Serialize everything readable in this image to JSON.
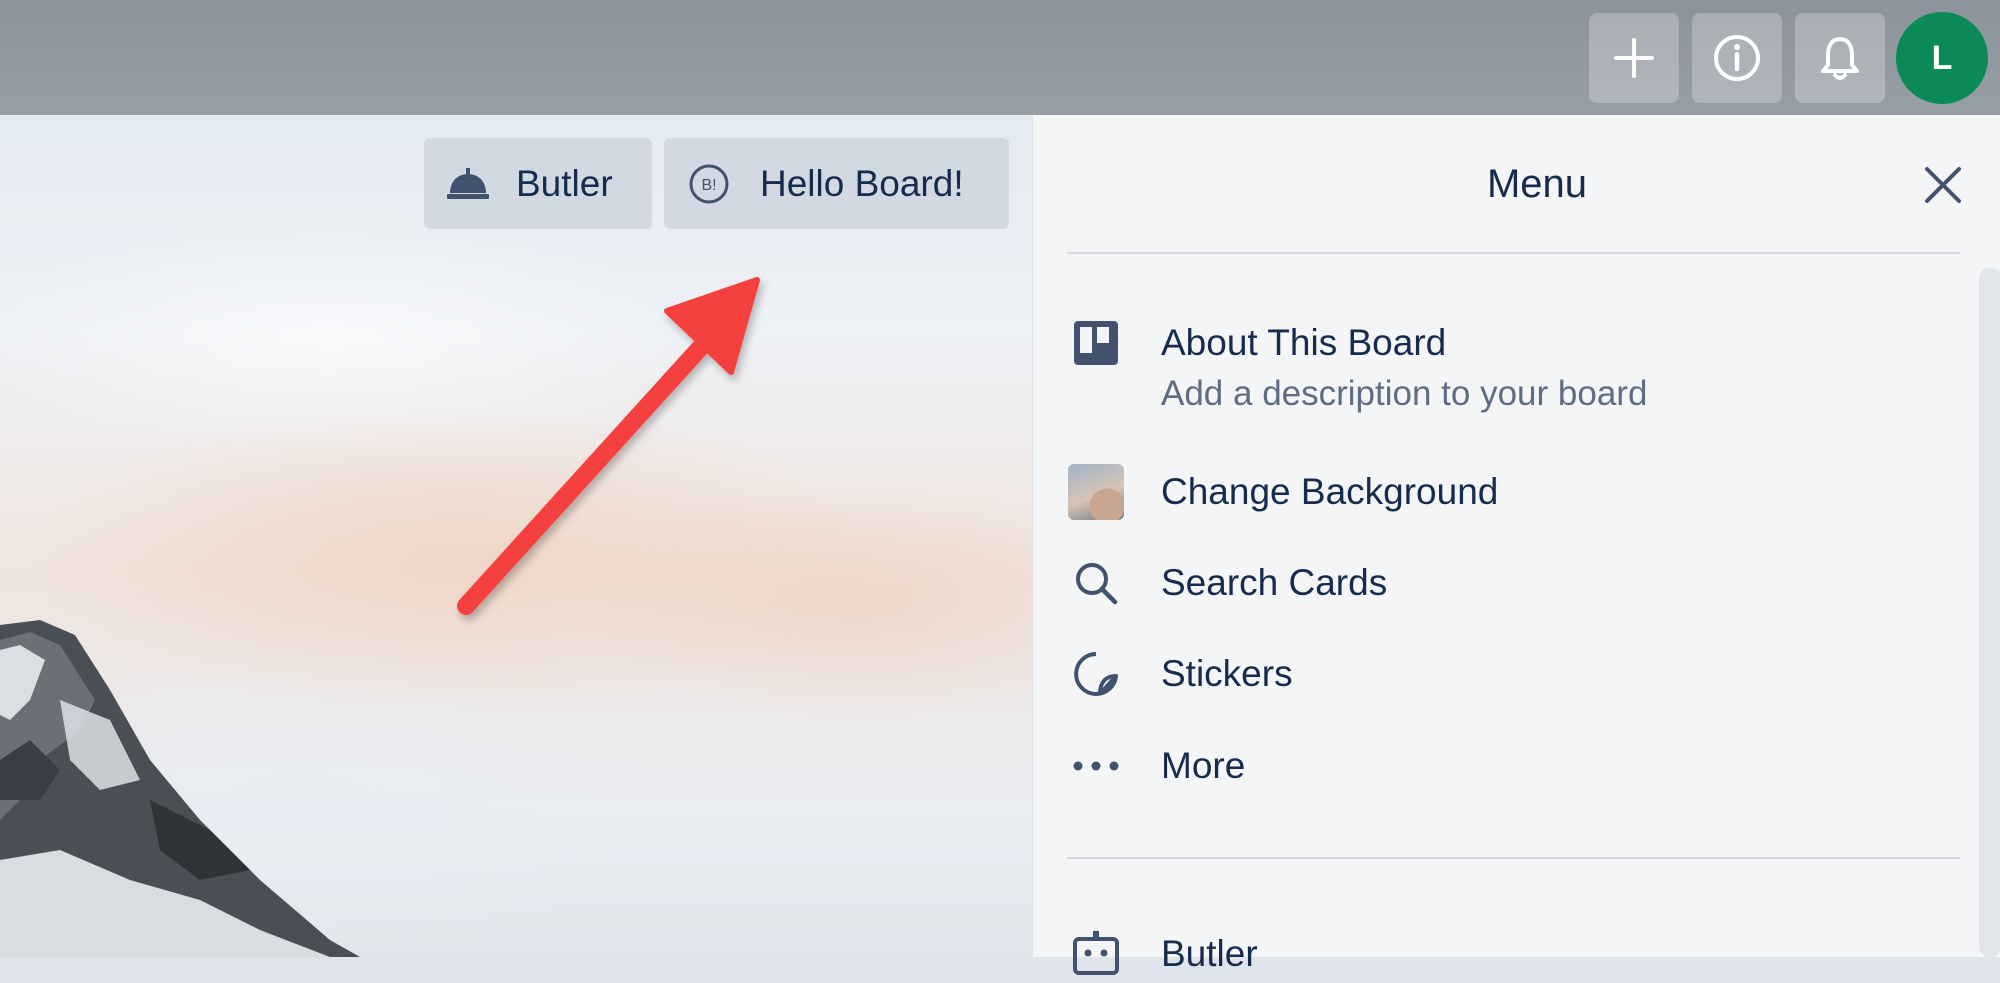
{
  "header": {
    "add_icon": "plus-icon",
    "info_icon": "info-icon",
    "notifications_icon": "bell-icon",
    "avatar_initial": "L",
    "avatar_color": "#0b8a57"
  },
  "board_header": {
    "butler_label": "Butler",
    "butler_icon": "bell-dome-icon",
    "power_up_label": "Hello Board!",
    "power_up_icon": "hello-board-icon"
  },
  "menu": {
    "title": "Menu",
    "items": [
      {
        "label": "About This Board",
        "sublabel": "Add a description to your board",
        "icon": "board-icon"
      },
      {
        "label": "Change Background",
        "icon": "background-thumbnail"
      },
      {
        "label": "Search Cards",
        "icon": "search-icon"
      },
      {
        "label": "Stickers",
        "icon": "sticker-icon"
      },
      {
        "label": "More",
        "icon": "more-icon"
      }
    ],
    "bottom_item": {
      "label": "Butler",
      "icon": "robot-icon"
    }
  },
  "annotation": {
    "arrow_color": "#f5413f"
  }
}
